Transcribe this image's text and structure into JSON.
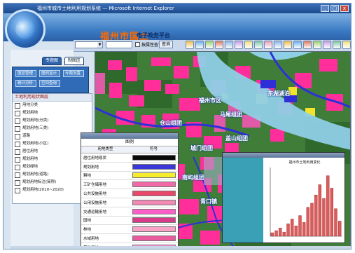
{
  "window": {
    "title": "福州市城市土地利用规划系统 — Microsoft Internet Explorer",
    "min": "_",
    "max": "□",
    "close": "x"
  },
  "banner": {
    "brand": "福州市国土",
    "subtitle": "电子政务平台"
  },
  "toolbar": {
    "checkbox_label": "按属性查询",
    "go_button": "查询",
    "icon_colors": [
      "#f2c14e",
      "#6fb0e8",
      "#9fd36a",
      "#e07a5f",
      "#8fb8e6",
      "#c9a0e6",
      "#f0e080",
      "#7fc6a4",
      "#e6a0b8",
      "#8fb8e6",
      "#f2c14e",
      "#6fb0e8",
      "#e07a5f",
      "#9fd36a",
      "#c9a0e6",
      "#7fc6a4",
      "#f0e080"
    ]
  },
  "tabs": [
    {
      "label": "专题图",
      "active": false
    },
    {
      "label": "制图区",
      "active": true
    }
  ],
  "nav": {
    "buttons": [
      "图层管理",
      "图例显示",
      "专题设置",
      "统计分析",
      "空间查询"
    ]
  },
  "layers": {
    "header": "土地利用现状图层",
    "items": [
      "用地分类",
      "规划用地",
      "规划用地(分类)",
      "规划用地(三类)",
      "道路",
      "规划用地(小区)",
      "居住用地",
      "规划用地",
      "规划绿地",
      "规划用地(道路)",
      "规划用地标注(简称)",
      "规划用地(2010~2020)"
    ]
  },
  "map": {
    "labels": [
      {
        "text": "福州市区",
        "pos": "upper-middle"
      },
      {
        "text": "仓山组团",
        "pos": "center-left"
      },
      {
        "text": "马尾组团",
        "pos": "center"
      },
      {
        "text": "盖山组团",
        "pos": "center-right"
      },
      {
        "text": "城门组团",
        "pos": "middle"
      },
      {
        "text": "南屿组团",
        "pos": "lower-left"
      },
      {
        "text": "青口镇",
        "pos": "lower-middle"
      },
      {
        "text": "东湖湖泊",
        "pos": "upper-right"
      }
    ]
  },
  "legend": {
    "title": "图例",
    "col_name": "用地类型",
    "col_symbol": "符号",
    "rows": [
      {
        "name": "居住用地现状",
        "color": "#0a0a0a"
      },
      {
        "name": "规划用地",
        "color": "#3a38d8"
      },
      {
        "name": "耕地",
        "color": "#f5ec2a"
      },
      {
        "name": "工矿仓储用地",
        "color": "#f06aa8"
      },
      {
        "name": "公共设施用地",
        "color": "#e8476a"
      },
      {
        "name": "公用设施用地",
        "color": "#f08ab4"
      },
      {
        "name": "交通运输用地",
        "color": "#ff5ec8"
      },
      {
        "name": "园地",
        "color": "#d93a8a"
      },
      {
        "name": "林地",
        "color": "#f9a3c8"
      },
      {
        "name": "水域用地",
        "color": "#e85a9c"
      },
      {
        "name": "其他用地",
        "color": "#ff8ad6"
      }
    ]
  },
  "chart_data": {
    "type": "bar",
    "title": "福州市土地利用变化",
    "categories": [
      "1",
      "2",
      "3",
      "4",
      "5",
      "6",
      "7",
      "8",
      "9",
      "10",
      "11",
      "12",
      "13",
      "14",
      "15",
      "16",
      "17",
      "18"
    ],
    "values": [
      5,
      8,
      12,
      6,
      18,
      25,
      15,
      30,
      20,
      42,
      48,
      60,
      75,
      55,
      88,
      70,
      40,
      22
    ],
    "ylim": [
      0,
      100
    ]
  }
}
